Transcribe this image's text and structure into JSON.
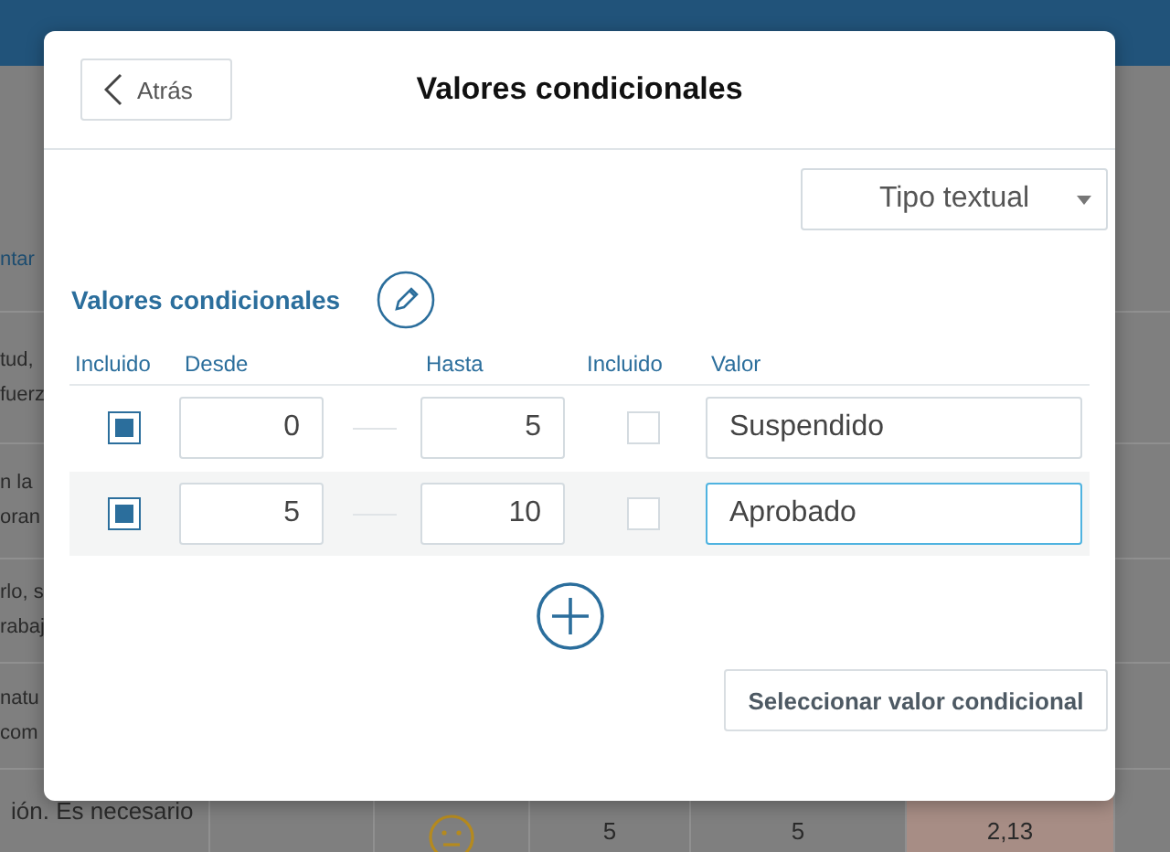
{
  "background": {
    "header_fragment": "ntar",
    "rows": [
      {
        "lines": [
          "tud,",
          "fuerz"
        ]
      },
      {
        "lines": [
          "n la",
          "oran"
        ]
      },
      {
        "lines": [
          "rlo, s",
          "rabaj"
        ]
      },
      {
        "lines": [
          "natu",
          "com"
        ]
      }
    ],
    "bottom_row": {
      "text": "ión. Es necesario",
      "cells": [
        "5",
        "5",
        "2,13"
      ]
    }
  },
  "dialog": {
    "back_button": "Atrás",
    "title": "Valores condicionales",
    "type_select": "Tipo textual",
    "section_title": "Valores condicionales",
    "columns": [
      "Incluido",
      "Desde",
      "Hasta",
      "Incluido",
      "Valor"
    ],
    "rows": [
      {
        "from_included": true,
        "from": "0",
        "to": "5",
        "to_included": false,
        "value": "Suspendido",
        "selected": false
      },
      {
        "from_included": true,
        "from": "5",
        "to": "10",
        "to_included": false,
        "value": "Aprobado",
        "selected": true
      }
    ],
    "select_button": "Seleccionar valor condicional"
  }
}
